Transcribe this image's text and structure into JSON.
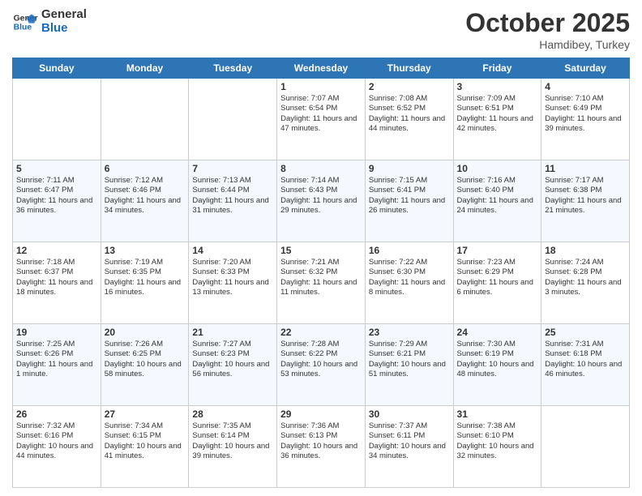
{
  "logo": {
    "line1": "General",
    "line2": "Blue"
  },
  "title": "October 2025",
  "subtitle": "Hamdibey, Turkey",
  "days": [
    "Sunday",
    "Monday",
    "Tuesday",
    "Wednesday",
    "Thursday",
    "Friday",
    "Saturday"
  ],
  "weeks": [
    [
      {
        "day": "",
        "info": ""
      },
      {
        "day": "",
        "info": ""
      },
      {
        "day": "",
        "info": ""
      },
      {
        "day": "1",
        "info": "Sunrise: 7:07 AM\nSunset: 6:54 PM\nDaylight: 11 hours and 47 minutes."
      },
      {
        "day": "2",
        "info": "Sunrise: 7:08 AM\nSunset: 6:52 PM\nDaylight: 11 hours and 44 minutes."
      },
      {
        "day": "3",
        "info": "Sunrise: 7:09 AM\nSunset: 6:51 PM\nDaylight: 11 hours and 42 minutes."
      },
      {
        "day": "4",
        "info": "Sunrise: 7:10 AM\nSunset: 6:49 PM\nDaylight: 11 hours and 39 minutes."
      }
    ],
    [
      {
        "day": "5",
        "info": "Sunrise: 7:11 AM\nSunset: 6:47 PM\nDaylight: 11 hours and 36 minutes."
      },
      {
        "day": "6",
        "info": "Sunrise: 7:12 AM\nSunset: 6:46 PM\nDaylight: 11 hours and 34 minutes."
      },
      {
        "day": "7",
        "info": "Sunrise: 7:13 AM\nSunset: 6:44 PM\nDaylight: 11 hours and 31 minutes."
      },
      {
        "day": "8",
        "info": "Sunrise: 7:14 AM\nSunset: 6:43 PM\nDaylight: 11 hours and 29 minutes."
      },
      {
        "day": "9",
        "info": "Sunrise: 7:15 AM\nSunset: 6:41 PM\nDaylight: 11 hours and 26 minutes."
      },
      {
        "day": "10",
        "info": "Sunrise: 7:16 AM\nSunset: 6:40 PM\nDaylight: 11 hours and 24 minutes."
      },
      {
        "day": "11",
        "info": "Sunrise: 7:17 AM\nSunset: 6:38 PM\nDaylight: 11 hours and 21 minutes."
      }
    ],
    [
      {
        "day": "12",
        "info": "Sunrise: 7:18 AM\nSunset: 6:37 PM\nDaylight: 11 hours and 18 minutes."
      },
      {
        "day": "13",
        "info": "Sunrise: 7:19 AM\nSunset: 6:35 PM\nDaylight: 11 hours and 16 minutes."
      },
      {
        "day": "14",
        "info": "Sunrise: 7:20 AM\nSunset: 6:33 PM\nDaylight: 11 hours and 13 minutes."
      },
      {
        "day": "15",
        "info": "Sunrise: 7:21 AM\nSunset: 6:32 PM\nDaylight: 11 hours and 11 minutes."
      },
      {
        "day": "16",
        "info": "Sunrise: 7:22 AM\nSunset: 6:30 PM\nDaylight: 11 hours and 8 minutes."
      },
      {
        "day": "17",
        "info": "Sunrise: 7:23 AM\nSunset: 6:29 PM\nDaylight: 11 hours and 6 minutes."
      },
      {
        "day": "18",
        "info": "Sunrise: 7:24 AM\nSunset: 6:28 PM\nDaylight: 11 hours and 3 minutes."
      }
    ],
    [
      {
        "day": "19",
        "info": "Sunrise: 7:25 AM\nSunset: 6:26 PM\nDaylight: 11 hours and 1 minute."
      },
      {
        "day": "20",
        "info": "Sunrise: 7:26 AM\nSunset: 6:25 PM\nDaylight: 10 hours and 58 minutes."
      },
      {
        "day": "21",
        "info": "Sunrise: 7:27 AM\nSunset: 6:23 PM\nDaylight: 10 hours and 56 minutes."
      },
      {
        "day": "22",
        "info": "Sunrise: 7:28 AM\nSunset: 6:22 PM\nDaylight: 10 hours and 53 minutes."
      },
      {
        "day": "23",
        "info": "Sunrise: 7:29 AM\nSunset: 6:21 PM\nDaylight: 10 hours and 51 minutes."
      },
      {
        "day": "24",
        "info": "Sunrise: 7:30 AM\nSunset: 6:19 PM\nDaylight: 10 hours and 48 minutes."
      },
      {
        "day": "25",
        "info": "Sunrise: 7:31 AM\nSunset: 6:18 PM\nDaylight: 10 hours and 46 minutes."
      }
    ],
    [
      {
        "day": "26",
        "info": "Sunrise: 7:32 AM\nSunset: 6:16 PM\nDaylight: 10 hours and 44 minutes."
      },
      {
        "day": "27",
        "info": "Sunrise: 7:34 AM\nSunset: 6:15 PM\nDaylight: 10 hours and 41 minutes."
      },
      {
        "day": "28",
        "info": "Sunrise: 7:35 AM\nSunset: 6:14 PM\nDaylight: 10 hours and 39 minutes."
      },
      {
        "day": "29",
        "info": "Sunrise: 7:36 AM\nSunset: 6:13 PM\nDaylight: 10 hours and 36 minutes."
      },
      {
        "day": "30",
        "info": "Sunrise: 7:37 AM\nSunset: 6:11 PM\nDaylight: 10 hours and 34 minutes."
      },
      {
        "day": "31",
        "info": "Sunrise: 7:38 AM\nSunset: 6:10 PM\nDaylight: 10 hours and 32 minutes."
      },
      {
        "day": "",
        "info": ""
      }
    ]
  ]
}
